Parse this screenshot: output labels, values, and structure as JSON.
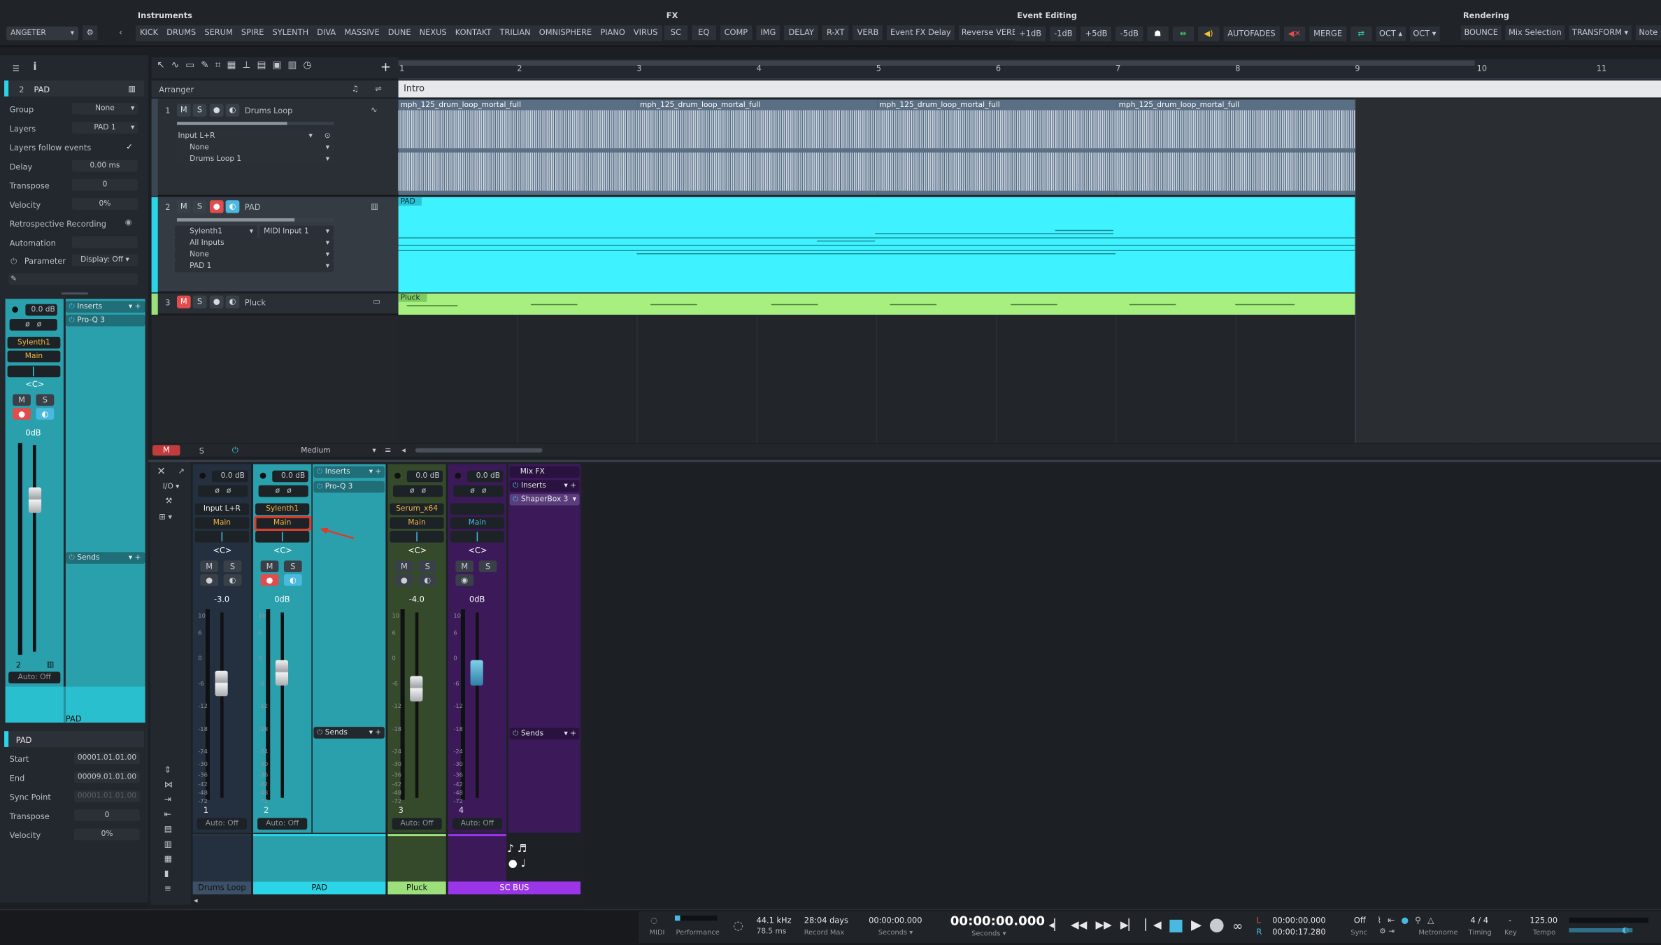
{
  "toolbar": {
    "preset": "ANGETER",
    "groups": {
      "instruments": "Instruments",
      "fx": "FX",
      "event_editing": "Event Editing",
      "rendering": "Rendering"
    },
    "instruments": [
      "KICK",
      "DRUMS",
      "SERUM",
      "SPIRE",
      "SYLENTH",
      "DIVA",
      "MASSIVE",
      "DUNE",
      "NEXUS",
      "KONTAKT",
      "TRILIAN",
      "OMNISPHERE",
      "PIANO",
      "VIRUS"
    ],
    "fx": [
      "SC",
      "EQ",
      "COMP",
      "IMG",
      "DELAY",
      "R-XT",
      "VERB",
      "Event FX Delay",
      "Reverse VERB"
    ],
    "event_editing": [
      "+1dB",
      "-1dB",
      "+5dB",
      "-5dB",
      "AUTOFADES",
      "MERGE",
      "OCT ▴",
      "OCT ▾"
    ],
    "rendering": [
      "BOUNCE",
      "Mix Selection",
      "TRANSFORM ▾",
      "Note FX"
    ]
  },
  "inspector": {
    "track_number": "2",
    "track_name": "PAD",
    "rows": [
      {
        "label": "Group",
        "value": "None"
      },
      {
        "label": "Layers",
        "value": "PAD 1"
      },
      {
        "label": "Layers follow events",
        "value": "✓"
      },
      {
        "label": "Delay",
        "value": "0.00 ms"
      },
      {
        "label": "Transpose",
        "value": "0"
      },
      {
        "label": "Velocity",
        "value": "0%"
      },
      {
        "label": "Retrospective Recording",
        "value": ""
      },
      {
        "label": "Automation",
        "value": ""
      }
    ],
    "parameter_label": "Parameter",
    "display_label": "Display: Off",
    "channel": {
      "gain": "0.0 dB",
      "instrument": "Sylenth1",
      "output": "Main",
      "pan": "<C>",
      "volume": "0dB",
      "number": "2",
      "auto": "Auto: Off",
      "name": "PAD",
      "inserts_label": "Inserts",
      "insert_plugin": "Pro-Q 3",
      "sends_label": "Sends"
    },
    "event": {
      "title": "PAD",
      "rows": [
        {
          "label": "Start",
          "value": "00001.01.01.00"
        },
        {
          "label": "End",
          "value": "00009.01.01.00"
        },
        {
          "label": "Sync Point",
          "value": "00001.01.01.00"
        },
        {
          "label": "Transpose",
          "value": "0"
        },
        {
          "label": "Velocity",
          "value": "0%"
        }
      ]
    }
  },
  "arranger": {
    "label": "Arranger",
    "section": "Intro",
    "ruler": [
      "1",
      "2",
      "3",
      "4",
      "5",
      "6",
      "7",
      "8",
      "9",
      "10",
      "11"
    ],
    "tracks": [
      {
        "num": "1",
        "name": "Drums Loop",
        "input": "Input L+R",
        "send": "None",
        "layer": "Drums Loop 1"
      },
      {
        "num": "2",
        "name": "PAD",
        "instrument": "Sylenth1",
        "midi": "MIDI Input 1",
        "inputs": "All Inputs",
        "send": "None",
        "layer": "PAD 1"
      },
      {
        "num": "3",
        "name": "Pluck"
      }
    ],
    "drum_clips": [
      "mph_125_drum_loop_mortal_full",
      "mph_125_drum_loop_mortal_full",
      "mph_125_drum_loop_mortal_full",
      "mph_125_drum_loop_mortal_full"
    ],
    "pad_clip": "PAD",
    "pluck_clip": "Pluck",
    "mix_bar": {
      "m": "M",
      "s": "S",
      "size": "Medium"
    }
  },
  "mixer": {
    "io": "I/O",
    "channels": [
      {
        "gain": "0.0 dB",
        "input": "Input L+R",
        "output": "Main",
        "pan": "<C>",
        "vol": "-3.0",
        "num": "1",
        "auto": "Auto: Off",
        "name": "Drums Loop",
        "color": "#2a3440"
      },
      {
        "gain": "0.0 dB",
        "input": "Sylenth1",
        "output": "Main",
        "pan": "<C>",
        "vol": "0dB",
        "num": "2",
        "auto": "Auto: Off",
        "name": "PAD",
        "color": "#2bd4e6"
      },
      {
        "gain": "0.0 dB",
        "input": "Serum_x64",
        "output": "Main",
        "pan": "<C>",
        "vol": "-4.0",
        "num": "3",
        "auto": "Auto: Off",
        "name": "Pluck",
        "color": "#9be07a"
      },
      {
        "gain": "0.0 dB",
        "input": "",
        "output": "Main",
        "pan": "<C>",
        "vol": "0dB",
        "num": "4",
        "auto": "Auto: Off",
        "name": "SC BUS",
        "color": "#9a35e8"
      }
    ],
    "pad_inserts": "Inserts",
    "pad_insert_plugin": "Pro-Q 3",
    "pad_sends": "Sends",
    "mixfx": {
      "title": "Mix FX",
      "inserts": "Inserts",
      "plugin": "ShaperBox 3",
      "sends": "Sends"
    },
    "scale": [
      "10",
      "6",
      "0",
      "-6",
      "-12",
      "-18",
      "-24",
      "-30",
      "-36",
      "-42",
      "-48",
      "-72"
    ]
  },
  "transport": {
    "midi": "MIDI",
    "performance": "Performance",
    "sample_rate": "44.1 kHz",
    "latency": "78.5 ms",
    "record_max": "28:04 days",
    "record_max_label": "Record Max",
    "pos1": "00:00:00.000",
    "pos1_label": "Seconds ▾",
    "main_time": "00:00:00.000",
    "main_label": "Seconds ▾",
    "loop_l": "00:00:00.000",
    "loop_r": "00:00:17.280",
    "sync_value": "Off",
    "sync_label": "Sync",
    "metronome_label": "Metronome",
    "timing_value": "4 / 4",
    "timing_label": "Timing",
    "key_value": "-",
    "key_label": "Key",
    "tempo_value": "125.00",
    "tempo_label": "Tempo"
  }
}
